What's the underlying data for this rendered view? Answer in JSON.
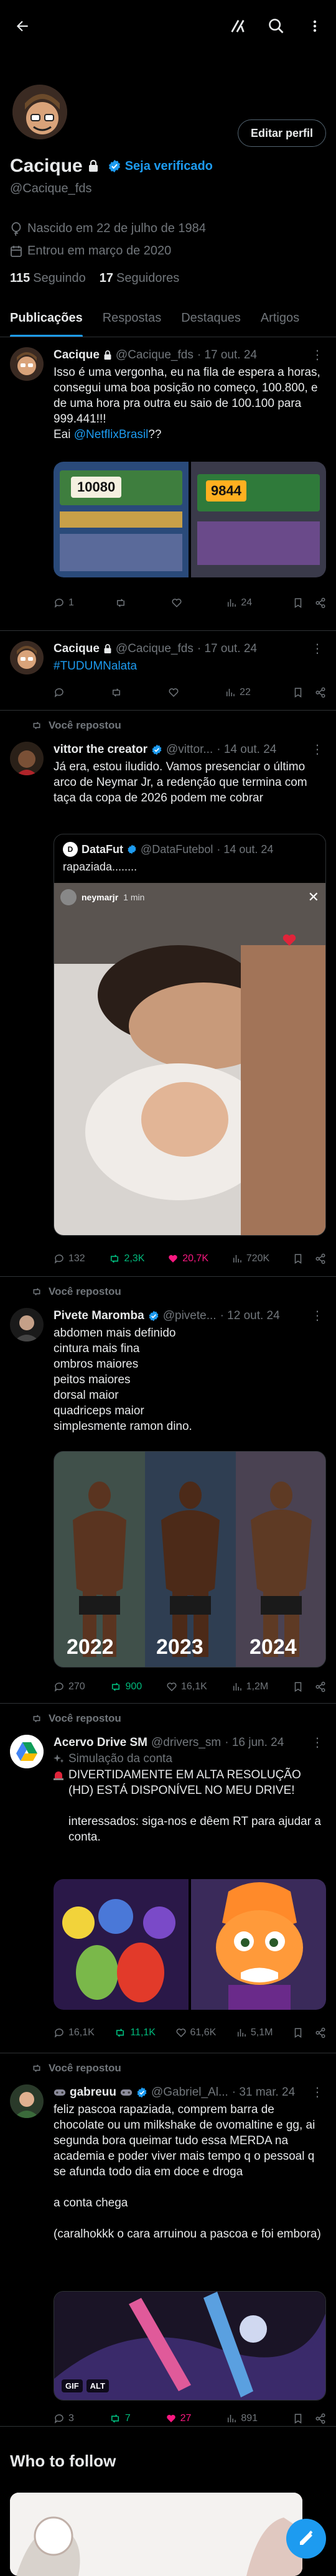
{
  "topbar": {
    "back_icon": "arrow-left-icon",
    "grok_icon": "grok-icon",
    "search_icon": "search-icon",
    "more_icon": "vertical-dots-icon"
  },
  "profile": {
    "name": "Cacique",
    "verify_label": "Seja verificado",
    "handle": "@Cacique_fds",
    "edit_button": "Editar perfil",
    "birth": "Nascido em 22 de julho de 1984",
    "joined": "Entrou em março de 2020",
    "following_count": "115",
    "following_label": "Seguindo",
    "followers_count": "17",
    "followers_label": "Seguidores"
  },
  "tabs": [
    "Publicações",
    "Respostas",
    "Destaques",
    "Artigos"
  ],
  "tweets": [
    {
      "name": "Cacique",
      "handle": "@Cacique_fds",
      "time": "· 17 out. 24",
      "text": "Isso é uma vergonha, eu na fila de espera a horas, consegui uma boa posição no começo, 100.800, e de uma hora pra outra eu saio de 100.100 para 999.441!!!\nEai ",
      "mention": "@NetflixBrasil",
      "text_tail": "??",
      "img_left": "10080",
      "img_right": "9844",
      "replies": "1",
      "retweets": "",
      "likes": "",
      "views": "24"
    },
    {
      "name": "Cacique",
      "handle": "@Cacique_fds",
      "time": "· 17 out. 24",
      "hashtag": "#TUDUMNalata",
      "replies": "",
      "retweets": "",
      "likes": "",
      "views": "22"
    },
    {
      "rt_label": "Você repostou",
      "name": "vittor the creator",
      "handle": "@vittor...",
      "time": "· 14 out. 24",
      "text": "Já era, estou iludido. Vamos presenciar o último arco de Neymar Jr, a redenção que termina com taça da copa de 2026 podem me cobrar",
      "quote": {
        "name": "DataFut",
        "handle": "@DataFutebol",
        "time": "· 14 out. 24",
        "text": "rapaziada........",
        "story_user": "neymarjr",
        "story_time": "1 min"
      },
      "replies": "132",
      "retweets": "2,3K",
      "likes": "20,7K",
      "views": "720K"
    },
    {
      "rt_label": "Você repostou",
      "name": "Pivete Maromba",
      "handle": "@pivete...",
      "time": "· 12 out. 24",
      "text": "abdomen mais definido\ncintura mais fina\nombros maiores\npeitos maiores\ndorsal maior\nquadriceps maior\nsimplesmente ramon dino.",
      "years": [
        "2022",
        "2023",
        "2024"
      ],
      "replies": "270",
      "retweets": "900",
      "likes": "16,1K",
      "views": "1,2M"
    },
    {
      "rt_label": "Você repostou",
      "name": "Acervo Drive SM",
      "handle": "@drivers_sm",
      "time": "· 16 jun. 24",
      "sub": "Simulação da conta",
      "text": "DIVERTIDAMENTE EM ALTA RESOLUÇÃO (HD) ESTÁ DISPONÍVEL NO MEU DRIVE!\n\ninteressados: siga-nos e dêem RT para ajudar a conta.",
      "replies": "",
      "retweets": "11,1K",
      "likes": "61,6K",
      "views": "5,1M",
      "reply_count": "16,1K"
    },
    {
      "rt_label": "Você repostou",
      "name": "gabreuu",
      "handle": "@Gabriel_Al...",
      "time": "· 31 mar. 24",
      "text": "feliz pascoa rapaziada, comprem barra de chocolate ou um milkshake de ovomaltine e gg, ai segunda bora queimar tudo essa MERDA na academia e poder viver mais tempo q o pessoal q se afunda todo dia em doce e droga\n\na conta chega\n\n(caralhokkk o cara arruinou a pascoa e foi embora)",
      "gif": "GIF",
      "alt": "ALT",
      "replies": "3",
      "retweets": "7",
      "likes": "27",
      "views": "891"
    }
  ],
  "who_to_follow": "Who to follow",
  "colors": {
    "accent": "#1d9bf0",
    "retweet": "#00ba7c",
    "like": "#f91880",
    "muted": "#71767b",
    "border": "#2f3336"
  }
}
